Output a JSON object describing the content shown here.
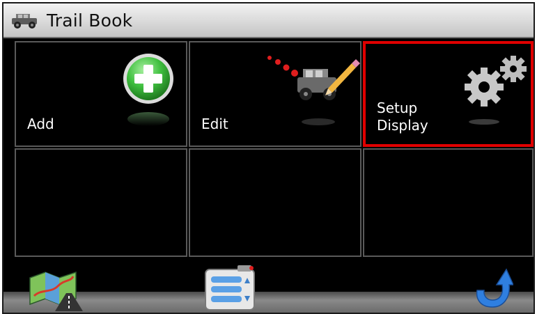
{
  "window": {
    "title": "Trail Book",
    "icon": "jeep-icon"
  },
  "tiles": [
    {
      "label": "Add",
      "icon": "add-plus-icon",
      "selected": false
    },
    {
      "label": "Edit",
      "icon": "edit-jeep-pencil-icon",
      "selected": false
    },
    {
      "label": "Setup\nDisplay",
      "icon": "gears-icon",
      "selected": true
    },
    {
      "label": "",
      "icon": "",
      "selected": false
    },
    {
      "label": "",
      "icon": "",
      "selected": false
    },
    {
      "label": "",
      "icon": "",
      "selected": false
    }
  ],
  "bottom_bar": {
    "buttons": [
      {
        "icon": "map-icon"
      },
      {
        "icon": "list-menu-icon"
      },
      {
        "icon": "back-arrow-icon"
      }
    ]
  },
  "colors": {
    "selection_border": "#e00000",
    "plus_green": "#3fbf3f",
    "back_arrow_blue": "#2f7fe0"
  }
}
